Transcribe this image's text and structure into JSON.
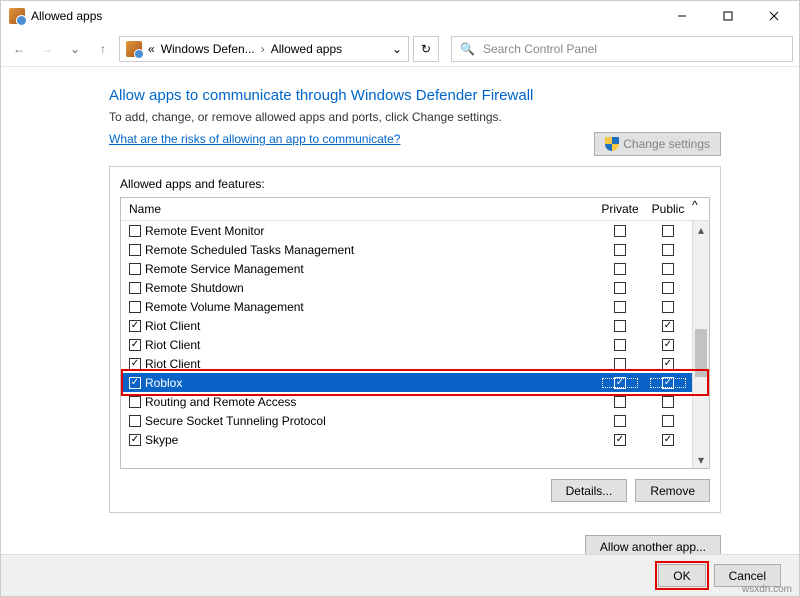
{
  "window": {
    "title": "Allowed apps"
  },
  "breadcrumb": {
    "prefix": "«",
    "part1": "Windows Defen...",
    "sep": "›",
    "part2": "Allowed apps"
  },
  "search": {
    "placeholder": "Search Control Panel"
  },
  "page": {
    "heading": "Allow apps to communicate through Windows Defender Firewall",
    "sub": "To add, change, or remove allowed apps and ports, click Change settings.",
    "risks_link": "What are the risks of allowing an app to communicate?",
    "change_settings": "Change settings",
    "group_label": "Allowed apps and features:",
    "columns": {
      "name": "Name",
      "private": "Private",
      "public": "Public"
    },
    "rows": [
      {
        "checked": false,
        "name": "Remote Event Monitor",
        "private": false,
        "public": false
      },
      {
        "checked": false,
        "name": "Remote Scheduled Tasks Management",
        "private": false,
        "public": false
      },
      {
        "checked": false,
        "name": "Remote Service Management",
        "private": false,
        "public": false
      },
      {
        "checked": false,
        "name": "Remote Shutdown",
        "private": false,
        "public": false
      },
      {
        "checked": false,
        "name": "Remote Volume Management",
        "private": false,
        "public": false
      },
      {
        "checked": true,
        "name": "Riot Client",
        "private": false,
        "public": true
      },
      {
        "checked": true,
        "name": "Riot Client",
        "private": false,
        "public": true
      },
      {
        "checked": true,
        "name": "Riot Client",
        "private": false,
        "public": true
      },
      {
        "checked": true,
        "name": "Roblox",
        "private": true,
        "public": true,
        "selected": true
      },
      {
        "checked": false,
        "name": "Routing and Remote Access",
        "private": false,
        "public": false
      },
      {
        "checked": false,
        "name": "Secure Socket Tunneling Protocol",
        "private": false,
        "public": false
      },
      {
        "checked": true,
        "name": "Skype",
        "private": true,
        "public": true
      }
    ],
    "details": "Details...",
    "remove": "Remove",
    "allow_another": "Allow another app..."
  },
  "footer": {
    "ok": "OK",
    "cancel": "Cancel"
  },
  "watermark": "wsxdn.com"
}
